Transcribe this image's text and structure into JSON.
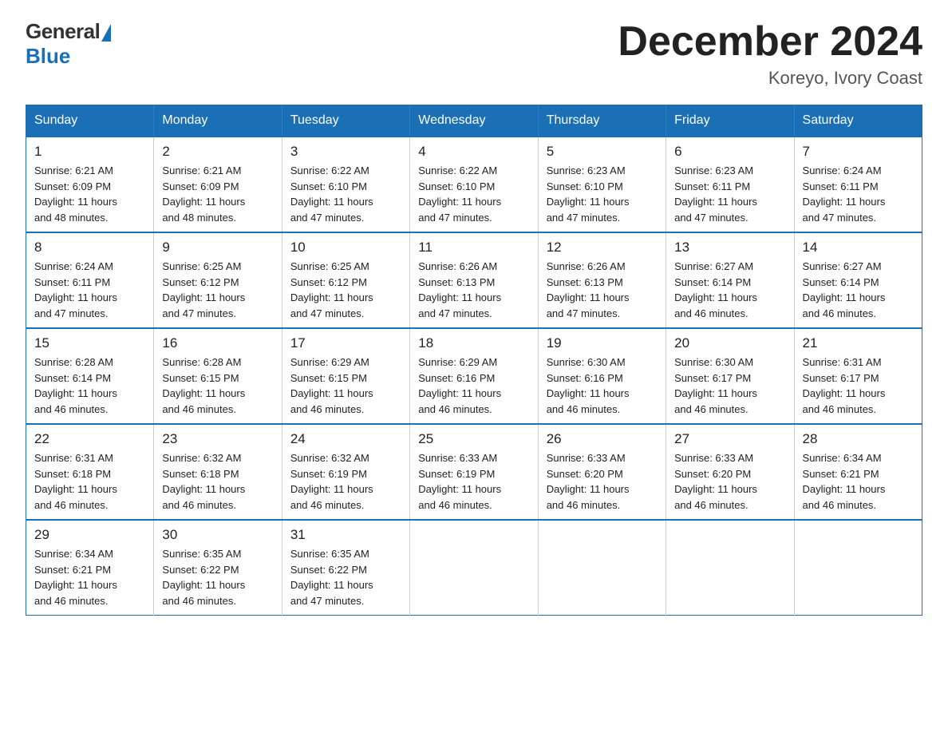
{
  "logo": {
    "general": "General",
    "blue": "Blue"
  },
  "title": "December 2024",
  "subtitle": "Koreyo, Ivory Coast",
  "headers": [
    "Sunday",
    "Monday",
    "Tuesday",
    "Wednesday",
    "Thursday",
    "Friday",
    "Saturday"
  ],
  "weeks": [
    [
      {
        "day": "1",
        "info": "Sunrise: 6:21 AM\nSunset: 6:09 PM\nDaylight: 11 hours\nand 48 minutes."
      },
      {
        "day": "2",
        "info": "Sunrise: 6:21 AM\nSunset: 6:09 PM\nDaylight: 11 hours\nand 48 minutes."
      },
      {
        "day": "3",
        "info": "Sunrise: 6:22 AM\nSunset: 6:10 PM\nDaylight: 11 hours\nand 47 minutes."
      },
      {
        "day": "4",
        "info": "Sunrise: 6:22 AM\nSunset: 6:10 PM\nDaylight: 11 hours\nand 47 minutes."
      },
      {
        "day": "5",
        "info": "Sunrise: 6:23 AM\nSunset: 6:10 PM\nDaylight: 11 hours\nand 47 minutes."
      },
      {
        "day": "6",
        "info": "Sunrise: 6:23 AM\nSunset: 6:11 PM\nDaylight: 11 hours\nand 47 minutes."
      },
      {
        "day": "7",
        "info": "Sunrise: 6:24 AM\nSunset: 6:11 PM\nDaylight: 11 hours\nand 47 minutes."
      }
    ],
    [
      {
        "day": "8",
        "info": "Sunrise: 6:24 AM\nSunset: 6:11 PM\nDaylight: 11 hours\nand 47 minutes."
      },
      {
        "day": "9",
        "info": "Sunrise: 6:25 AM\nSunset: 6:12 PM\nDaylight: 11 hours\nand 47 minutes."
      },
      {
        "day": "10",
        "info": "Sunrise: 6:25 AM\nSunset: 6:12 PM\nDaylight: 11 hours\nand 47 minutes."
      },
      {
        "day": "11",
        "info": "Sunrise: 6:26 AM\nSunset: 6:13 PM\nDaylight: 11 hours\nand 47 minutes."
      },
      {
        "day": "12",
        "info": "Sunrise: 6:26 AM\nSunset: 6:13 PM\nDaylight: 11 hours\nand 47 minutes."
      },
      {
        "day": "13",
        "info": "Sunrise: 6:27 AM\nSunset: 6:14 PM\nDaylight: 11 hours\nand 46 minutes."
      },
      {
        "day": "14",
        "info": "Sunrise: 6:27 AM\nSunset: 6:14 PM\nDaylight: 11 hours\nand 46 minutes."
      }
    ],
    [
      {
        "day": "15",
        "info": "Sunrise: 6:28 AM\nSunset: 6:14 PM\nDaylight: 11 hours\nand 46 minutes."
      },
      {
        "day": "16",
        "info": "Sunrise: 6:28 AM\nSunset: 6:15 PM\nDaylight: 11 hours\nand 46 minutes."
      },
      {
        "day": "17",
        "info": "Sunrise: 6:29 AM\nSunset: 6:15 PM\nDaylight: 11 hours\nand 46 minutes."
      },
      {
        "day": "18",
        "info": "Sunrise: 6:29 AM\nSunset: 6:16 PM\nDaylight: 11 hours\nand 46 minutes."
      },
      {
        "day": "19",
        "info": "Sunrise: 6:30 AM\nSunset: 6:16 PM\nDaylight: 11 hours\nand 46 minutes."
      },
      {
        "day": "20",
        "info": "Sunrise: 6:30 AM\nSunset: 6:17 PM\nDaylight: 11 hours\nand 46 minutes."
      },
      {
        "day": "21",
        "info": "Sunrise: 6:31 AM\nSunset: 6:17 PM\nDaylight: 11 hours\nand 46 minutes."
      }
    ],
    [
      {
        "day": "22",
        "info": "Sunrise: 6:31 AM\nSunset: 6:18 PM\nDaylight: 11 hours\nand 46 minutes."
      },
      {
        "day": "23",
        "info": "Sunrise: 6:32 AM\nSunset: 6:18 PM\nDaylight: 11 hours\nand 46 minutes."
      },
      {
        "day": "24",
        "info": "Sunrise: 6:32 AM\nSunset: 6:19 PM\nDaylight: 11 hours\nand 46 minutes."
      },
      {
        "day": "25",
        "info": "Sunrise: 6:33 AM\nSunset: 6:19 PM\nDaylight: 11 hours\nand 46 minutes."
      },
      {
        "day": "26",
        "info": "Sunrise: 6:33 AM\nSunset: 6:20 PM\nDaylight: 11 hours\nand 46 minutes."
      },
      {
        "day": "27",
        "info": "Sunrise: 6:33 AM\nSunset: 6:20 PM\nDaylight: 11 hours\nand 46 minutes."
      },
      {
        "day": "28",
        "info": "Sunrise: 6:34 AM\nSunset: 6:21 PM\nDaylight: 11 hours\nand 46 minutes."
      }
    ],
    [
      {
        "day": "29",
        "info": "Sunrise: 6:34 AM\nSunset: 6:21 PM\nDaylight: 11 hours\nand 46 minutes."
      },
      {
        "day": "30",
        "info": "Sunrise: 6:35 AM\nSunset: 6:22 PM\nDaylight: 11 hours\nand 46 minutes."
      },
      {
        "day": "31",
        "info": "Sunrise: 6:35 AM\nSunset: 6:22 PM\nDaylight: 11 hours\nand 47 minutes."
      },
      {
        "day": "",
        "info": ""
      },
      {
        "day": "",
        "info": ""
      },
      {
        "day": "",
        "info": ""
      },
      {
        "day": "",
        "info": ""
      }
    ]
  ]
}
